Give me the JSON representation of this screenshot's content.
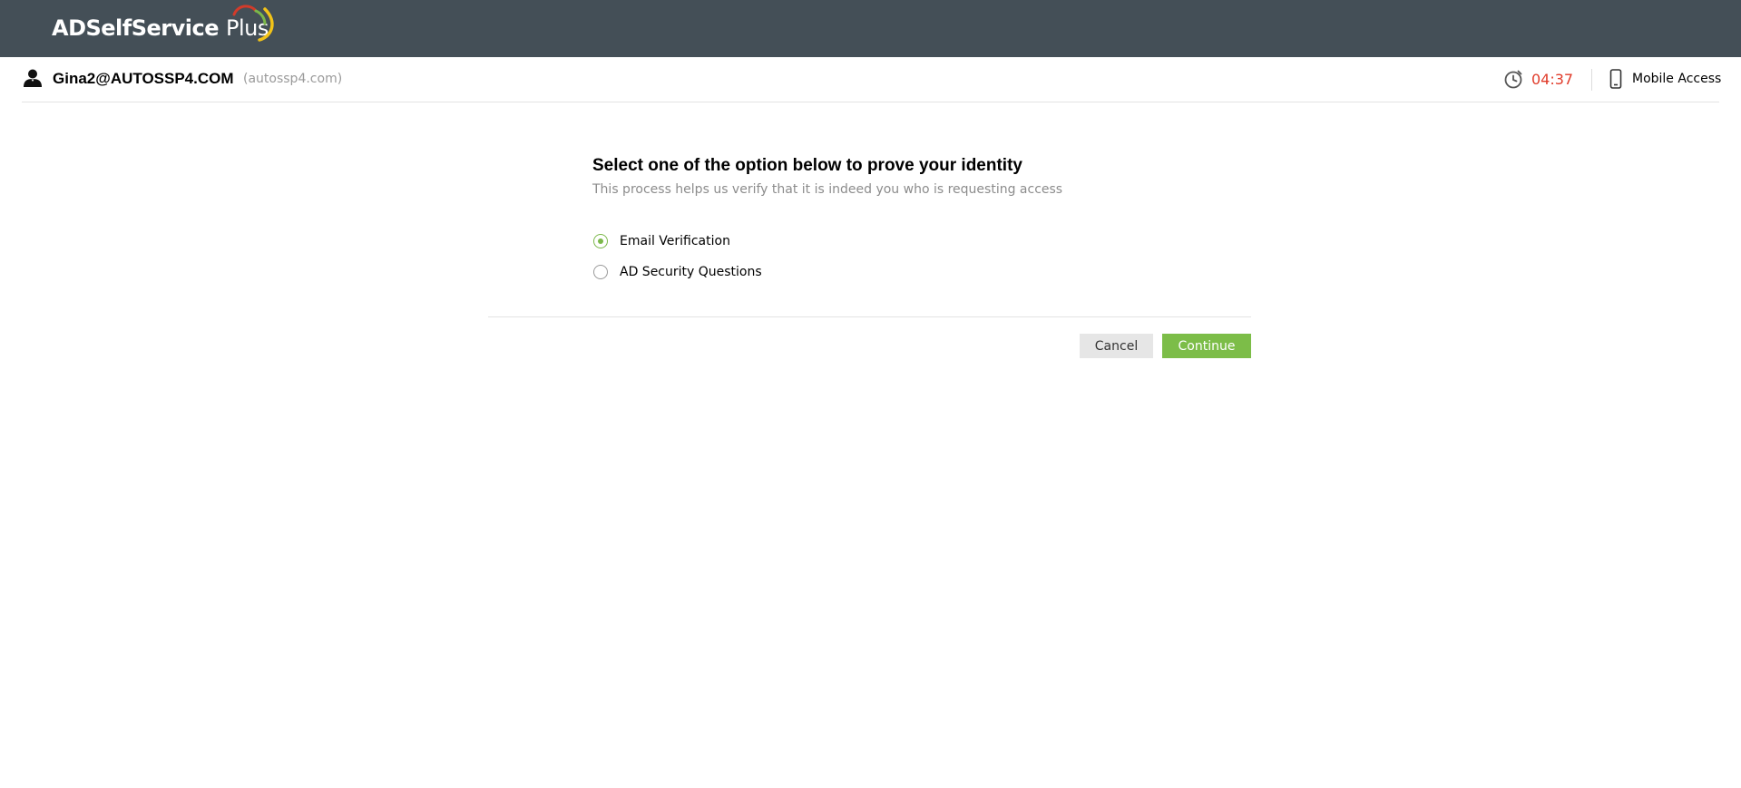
{
  "header": {
    "brand_bold": "ADSelfService",
    "brand_light": "Plus",
    "colors": {
      "bar": "#444f57",
      "arc_red": "#d23b2a",
      "arc_green": "#7bb84a",
      "arc_yellow": "#f2c318"
    }
  },
  "user": {
    "icon": "user-icon",
    "name": "Gina2@AUTOSSP4.COM",
    "domain": "(autossp4.com)"
  },
  "session": {
    "timer_icon": "clock-icon",
    "timer": "04:37",
    "timer_color": "#e03b2a",
    "mobile_icon": "mobile-phone-icon",
    "mobile_label": "Mobile Access"
  },
  "panel": {
    "title": "Select one of the option below to prove your identity",
    "subtitle": "This process helps us verify that it is indeed you who is requesting access",
    "options": [
      {
        "label": "Email Verification",
        "selected": true
      },
      {
        "label": "AD Security Questions",
        "selected": false
      }
    ],
    "cancel_label": "Cancel",
    "continue_label": "Continue",
    "accent": "#7cbd48"
  }
}
